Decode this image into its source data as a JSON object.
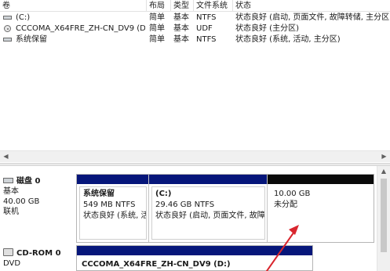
{
  "volume_list": {
    "columns": [
      "卷",
      "布局",
      "类型",
      "文件系统",
      "状态"
    ],
    "rows": [
      {
        "volume": "(C:)",
        "layout": "简单",
        "type": "基本",
        "fs": "NTFS",
        "status": "状态良好 (启动, 页面文件, 故障转储, 主分区)",
        "icon": "drive-icon"
      },
      {
        "volume": "CCCOMA_X64FRE_ZH-CN_DV9 (D:)",
        "layout": "简单",
        "type": "基本",
        "fs": "UDF",
        "status": "状态良好 (主分区)",
        "icon": "disc-icon"
      },
      {
        "volume": "系统保留",
        "layout": "简单",
        "type": "基本",
        "fs": "NTFS",
        "status": "状态良好 (系统, 活动, 主分区)",
        "icon": "drive-icon"
      }
    ]
  },
  "scrollbar": {
    "left_arrow": "◀",
    "right_arrow": "▶",
    "up_arrow": "▲"
  },
  "disk0": {
    "title": "磁盘 0",
    "type": "基本",
    "size": "40.00 GB",
    "state": "联机",
    "partitions": [
      {
        "name": "系统保留",
        "size_fs": "549 MB NTFS",
        "status": "状态良好 (系统, 活",
        "bar": "#06167a"
      },
      {
        "name": "(C:)",
        "size_fs": "29.46 GB NTFS",
        "status": "状态良好 (启动, 页面文件, 故障",
        "bar": "#06167a"
      },
      {
        "name": "",
        "size_fs": "10.00 GB",
        "status": "未分配",
        "bar": "#0a0a0a"
      }
    ]
  },
  "cdrom0": {
    "title": "CD-ROM 0",
    "type": "DVD",
    "volume_label": "CCCOMA_X64FRE_ZH-CN_DV9  (D:)"
  },
  "annotation": {
    "arrow_color": "#d9262e"
  }
}
